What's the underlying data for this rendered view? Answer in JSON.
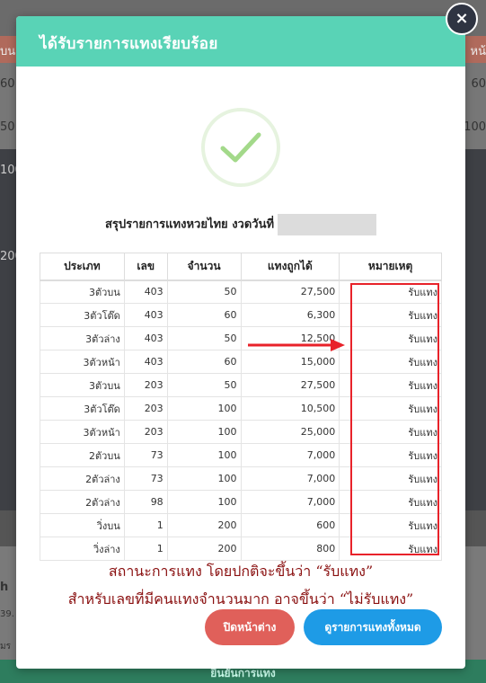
{
  "background": {
    "left_values": [
      "บน",
      "60",
      "50",
      "100",
      "200"
    ],
    "right_values": [
      "หน้",
      "60",
      "100"
    ],
    "bottom_left": [
      "h",
      "39.",
      "มร"
    ],
    "bottom_bar_label": "ยืนยันการแทง"
  },
  "modal": {
    "title": "ได้รับรายการแทงเรียบร้อย",
    "close_glyph": "×",
    "summary_label": "สรุปรายการแทงหวยไทย งวดวันที่",
    "table": {
      "headers": [
        "ประเภท",
        "เลข",
        "จำนวน",
        "แทงถูกได้",
        "หมายเหตุ"
      ],
      "rows": [
        [
          "3ตัวบน",
          "403",
          "50",
          "27,500",
          "รับแทง"
        ],
        [
          "3ตัวโต๊ด",
          "403",
          "60",
          "6,300",
          "รับแทง"
        ],
        [
          "3ตัวล่าง",
          "403",
          "50",
          "12,500",
          "รับแทง"
        ],
        [
          "3ตัวหน้า",
          "403",
          "60",
          "15,000",
          "รับแทง"
        ],
        [
          "3ตัวบน",
          "203",
          "50",
          "27,500",
          "รับแทง"
        ],
        [
          "3ตัวโต๊ด",
          "203",
          "100",
          "10,500",
          "รับแทง"
        ],
        [
          "3ตัวหน้า",
          "203",
          "100",
          "25,000",
          "รับแทง"
        ],
        [
          "2ตัวบน",
          "73",
          "100",
          "7,000",
          "รับแทง"
        ],
        [
          "2ตัวล่าง",
          "73",
          "100",
          "7,000",
          "รับแทง"
        ],
        [
          "2ตัวล่าง",
          "98",
          "100",
          "7,000",
          "รับแทง"
        ],
        [
          "วิ่งบน",
          "1",
          "200",
          "600",
          "รับแทง"
        ],
        [
          "วิ่งล่าง",
          "1",
          "200",
          "800",
          "รับแทง"
        ]
      ]
    },
    "annotation_line1": "สถานะการแทง โดยปกติจะขึ้นว่า “รับแทง”",
    "annotation_line2": "สำหรับเลขที่มีคนแทงจำนวนมาก อาจขึ้นว่า “ไม่รับแทง”",
    "close_button": "ปิดหน้าต่าง",
    "view_all_button": "ดูรายการแทงทั้งหมด"
  },
  "colors": {
    "header": "#59d3b6",
    "close_button": "#e0605a",
    "view_all_button": "#1e9be6",
    "annotation": "#8a1010",
    "highlight": "#e8222a"
  }
}
